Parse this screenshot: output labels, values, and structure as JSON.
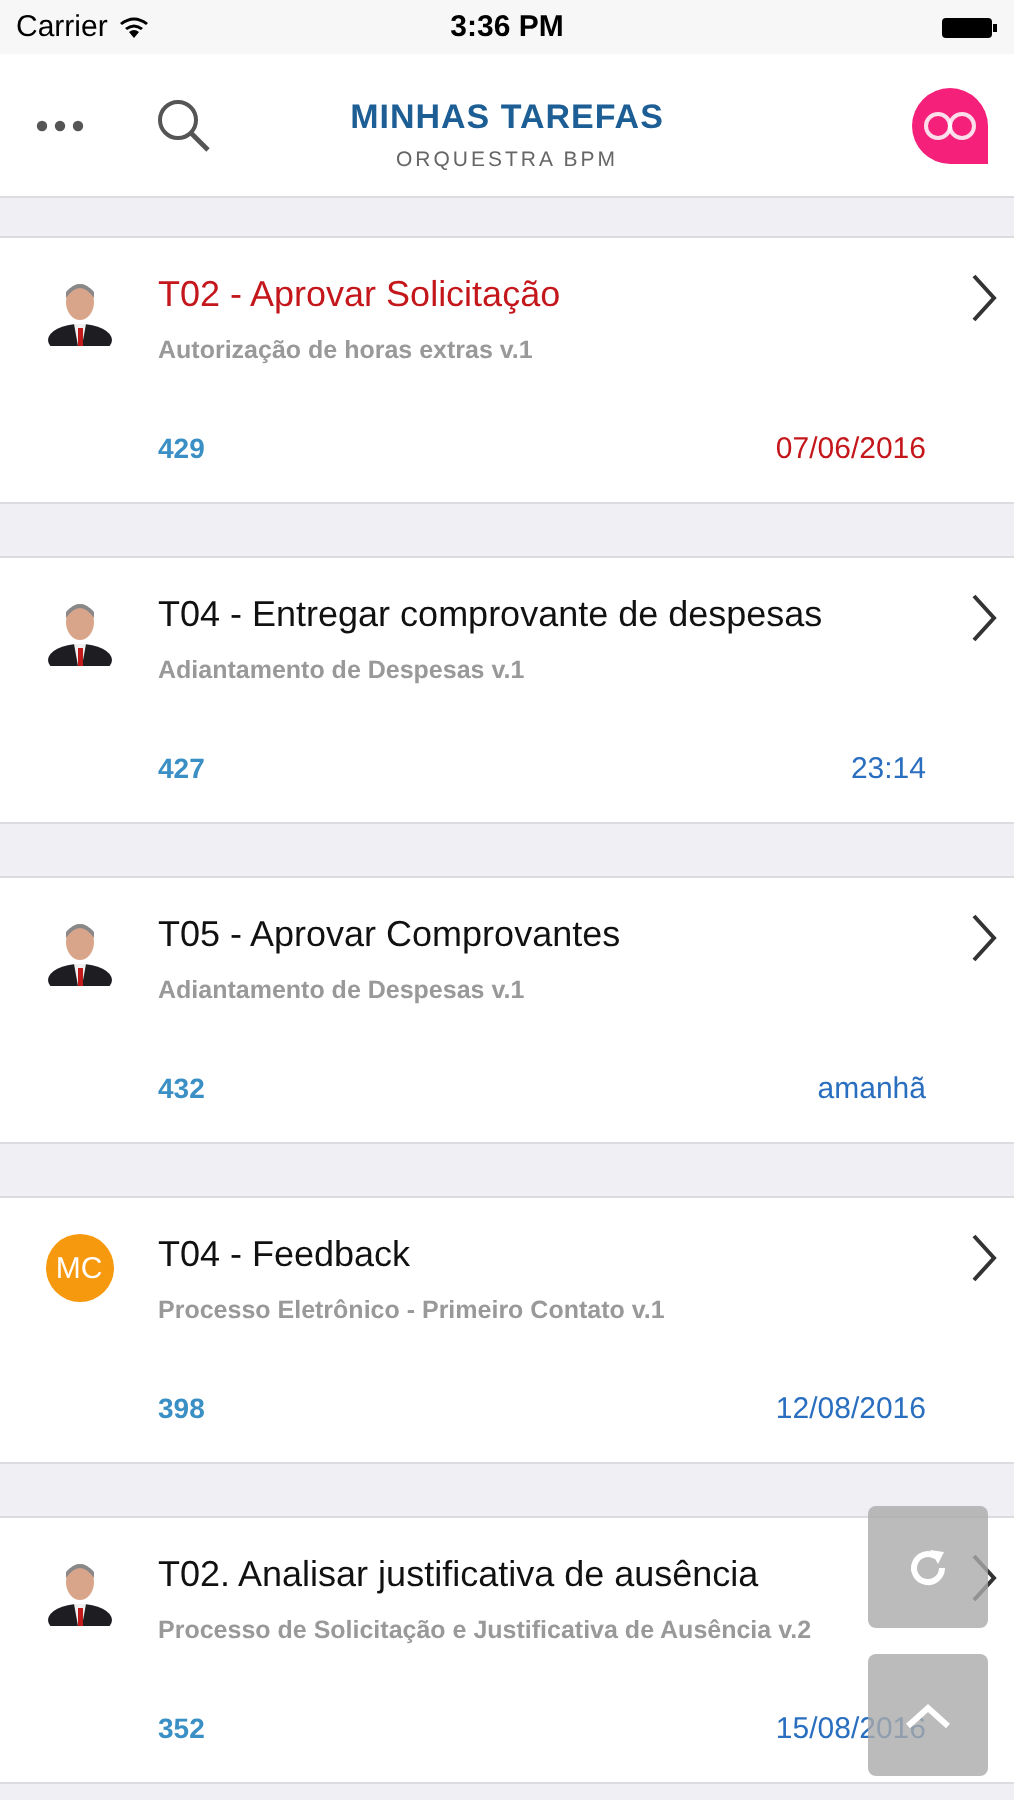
{
  "status_bar": {
    "carrier": "Carrier",
    "time": "3:36 PM"
  },
  "header": {
    "title": "MINHAS TAREFAS",
    "subtitle": "ORQUESTRA BPM"
  },
  "tasks": [
    {
      "title": "T02 - Aprovar Solicitação",
      "process": "Autorização de horas extras v.1",
      "number": "429",
      "due": "07/06/2016",
      "overdue": true
    },
    {
      "title": "T04 - Entregar comprovante de despesas",
      "process": "Adiantamento de Despesas v.1",
      "number": "427",
      "due": "23:14",
      "overdue": false
    },
    {
      "title": "T05 - Aprovar Comprovantes",
      "process": "Adiantamento de Despesas v.1",
      "number": "432",
      "due": "amanhã",
      "overdue": false
    },
    {
      "title": "T04 - Feedback",
      "process": "Processo Eletrônico - Primeiro Contato v.1",
      "number": "398",
      "due": "12/08/2016",
      "overdue": false,
      "avatar": {
        "kind": "initials",
        "text": "MC",
        "color": "#f7990f"
      }
    },
    {
      "title": "T02. Analisar justificativa de ausência",
      "process": "Processo de Solicitação e Justificativa de Ausência v.2",
      "number": "352",
      "due": "15/08/2016",
      "overdue": false
    }
  ]
}
